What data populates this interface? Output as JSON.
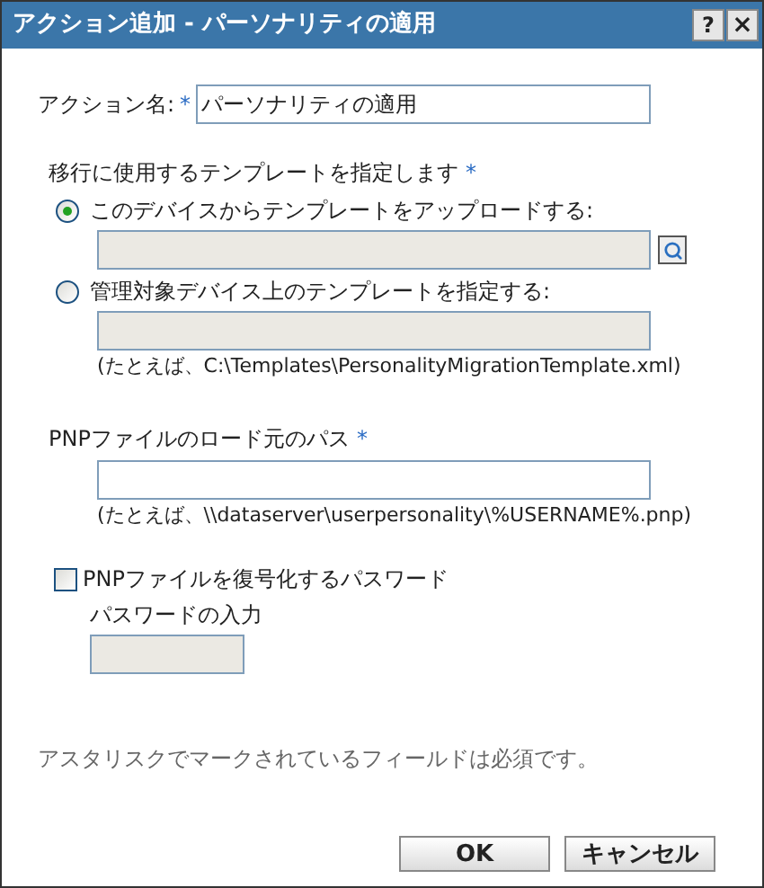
{
  "window": {
    "title": "アクション追加 - パーソナリティの適用",
    "help_button": "?",
    "close_button": "×"
  },
  "action_name": {
    "label": "アクション名:",
    "required_mark": "*",
    "value": "パーソナリティの適用"
  },
  "template": {
    "label": "移行に使用するテンプレートを指定します",
    "required_mark": "*",
    "options": [
      {
        "label": "このデバイスからテンプレートをアップロードする:",
        "selected": true,
        "kind": "browse",
        "disabled": true
      },
      {
        "label": "管理対象デバイス上のテンプレートを指定する:",
        "selected": false,
        "kind": "path",
        "disabled": true,
        "hint": "(たとえば、C:\\Templates\\PersonalityMigrationTemplate.xml)"
      }
    ]
  },
  "pnp_path": {
    "label": "PNPファイルのロード元のパス",
    "required_mark": "*",
    "hint": "(たとえば、\\\\dataserver\\userpersonality\\%USERNAME%.pnp)"
  },
  "password": {
    "label": "PNPファイルを復号化するパスワード",
    "checked": false,
    "field_label": "パスワードの入力",
    "disabled": true
  },
  "note": "アスタリスクでマークされているフィールドは必須です。",
  "buttons": [
    "OK",
    "キャンセル"
  ]
}
